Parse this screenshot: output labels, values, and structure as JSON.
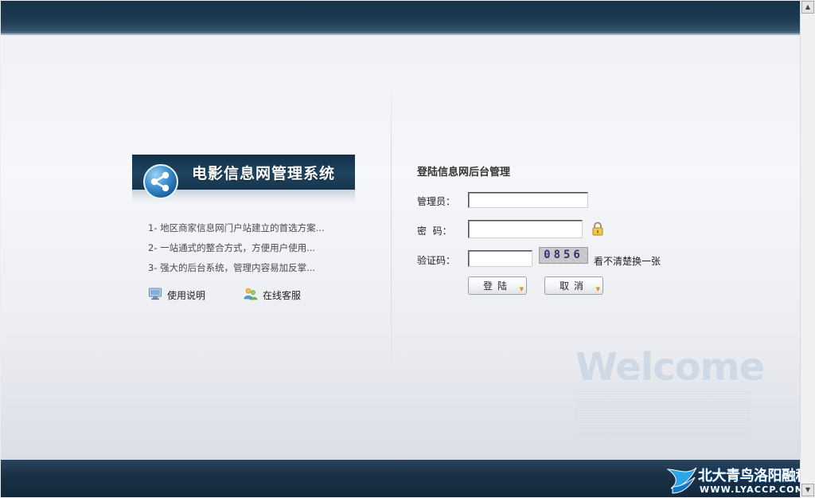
{
  "left_panel": {
    "banner_title": "电影信息网管理系统",
    "features": [
      "1- 地区商家信息网门户站建立的首选方案...",
      "2- 一站通式的整合方式，方便用户使用...",
      "3- 强大的后台系统，管理内容易加反掌..."
    ],
    "links": {
      "manual": "使用说明",
      "support": "在线客服"
    }
  },
  "login": {
    "title": "登陆信息网后台管理",
    "username_label": "管理员：",
    "username_value": "",
    "password_label": "密  码：",
    "password_value": "",
    "captcha_label": "验证码：",
    "captcha_value": "",
    "captcha_code": "0856",
    "refresh_link": "看不清楚换一张",
    "login_button": "登陆",
    "cancel_button": "取消"
  },
  "decor": {
    "welcome_text": "Welcome"
  },
  "watermark": {
    "title": "北大青鸟洛阳融科",
    "url": "WWW.LYACCP.COM"
  },
  "icons": {
    "banner_logo": "share-icon",
    "manual": "monitor-icon",
    "support": "users-icon",
    "password_lock": "lock-icon"
  },
  "colors": {
    "header_bar": "#1d3b52",
    "footer_bar": "#1a3146",
    "banner": "#1e4460",
    "welcome": "#cfd9e5"
  }
}
